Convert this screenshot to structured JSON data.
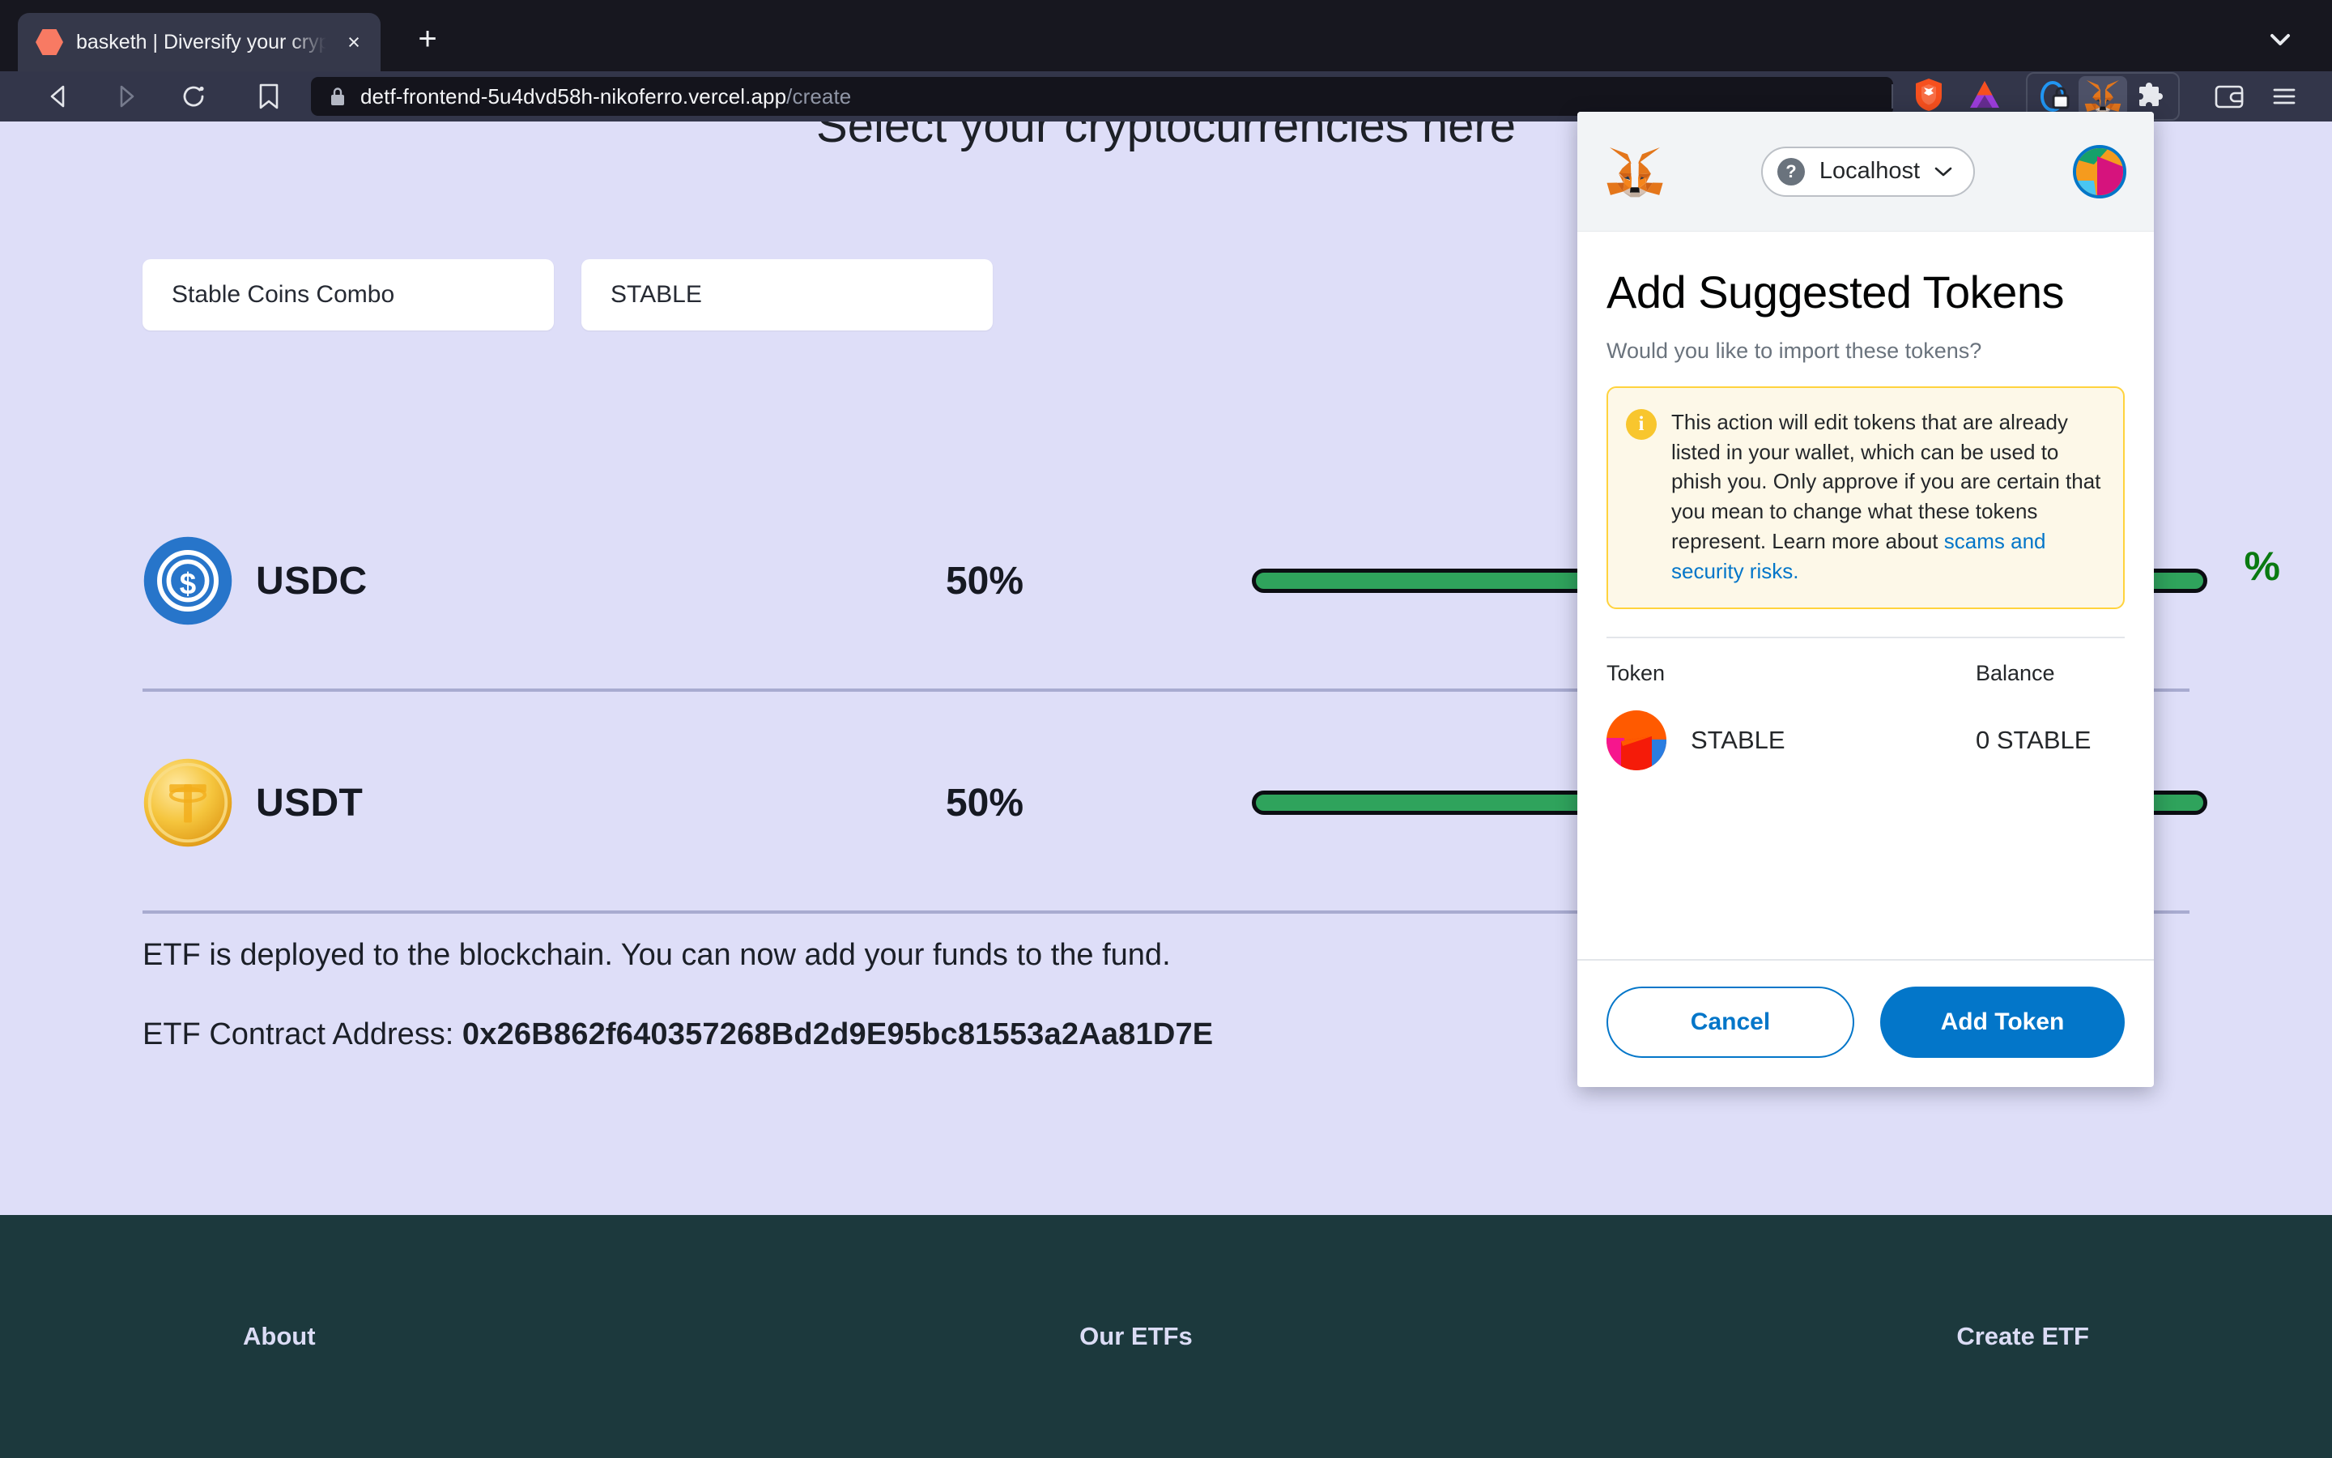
{
  "browser": {
    "name": "Brave",
    "tab": {
      "title": "basketh | Diversify your crypto i",
      "favicon": "hexagon-favicon",
      "close_label": "×"
    },
    "newtab_label": "+",
    "nav": {
      "back": "back-arrow",
      "forward": "forward-arrow",
      "reload": "reload-icon",
      "bookmark": "bookmark-icon"
    },
    "url": {
      "lock": "lock-icon",
      "host": "detf-frontend-5u4dvd58h-nikoferro.vercel.app",
      "path": "/create"
    },
    "toolbar_icons": [
      "brave-shield-icon",
      "brave-rewards-icon",
      "privacy-lock-extension-icon",
      "metamask-extension-icon",
      "extensions-puzzle-icon",
      "wallet-icon",
      "browser-menu-icon"
    ],
    "tab_search": "chevron-down-icon"
  },
  "page": {
    "heading": "Select your cryptocurrencies here",
    "fields": [
      {
        "name": "etf-name-input",
        "value": "Stable Coins Combo"
      },
      {
        "name": "etf-symbol-input",
        "value": "STABLE"
      }
    ],
    "total_percent": "%",
    "coins": [
      {
        "symbol": "USDC",
        "percent": "50%",
        "icon": "usdc-coin-icon",
        "slider_value": 50
      },
      {
        "symbol": "USDT",
        "percent": "50%",
        "icon": "usdt-coin-icon",
        "slider_value": 50
      }
    ],
    "deploy_text": "ETF is deployed to the blockchain. You can now add your funds to the fund.",
    "contract_label": "ETF Contract Address: ",
    "contract_address": "0x26B862f640357268Bd2d9E95bc81553a2Aa81D7E",
    "footer_links": [
      "About",
      "Our ETFs",
      "Create ETF"
    ],
    "colors": {
      "background": "#dedef8",
      "footer": "#1c393d",
      "slider_fill": "#2fa35c",
      "total_percent": "#0a7a11"
    }
  },
  "metamask": {
    "network": {
      "label": "Localhost",
      "badge": "?"
    },
    "title": "Add Suggested Tokens",
    "subtitle": "Would you like to import these tokens?",
    "warning": {
      "icon": "info-icon",
      "text": "This action will edit tokens that are already listed in your wallet, which can be used to phish you. Only approve if you are certain that you mean to change what these tokens represent. Learn more about ",
      "link_text": "scams and security risks."
    },
    "table": {
      "headers": {
        "token": "Token",
        "balance": "Balance"
      },
      "rows": [
        {
          "token": "STABLE",
          "balance": "0 STABLE",
          "icon": "token-blockie-icon"
        }
      ]
    },
    "buttons": {
      "cancel": "Cancel",
      "confirm": "Add Token"
    },
    "colors": {
      "primary": "#0376c9",
      "warning_bg": "#fdf8e8",
      "warning_border": "#ffd33d"
    }
  }
}
